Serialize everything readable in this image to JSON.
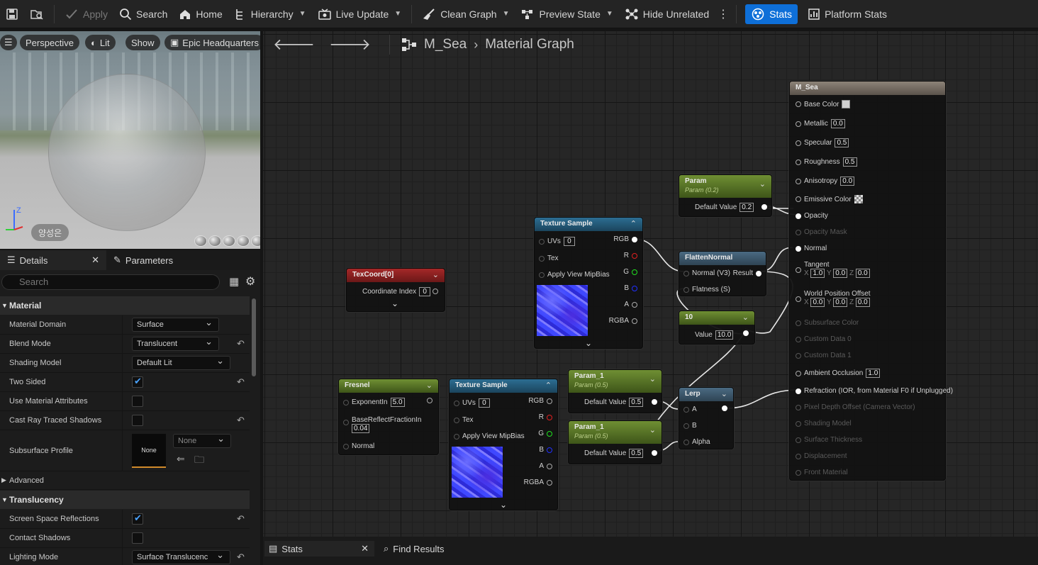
{
  "toolbar": {
    "apply": "Apply",
    "search": "Search",
    "home": "Home",
    "hierarchy": "Hierarchy",
    "live_update": "Live Update",
    "clean_graph": "Clean Graph",
    "preview_state": "Preview State",
    "hide_unrelated": "Hide Unrelated",
    "stats": "Stats",
    "platform_stats": "Platform Stats"
  },
  "viewport": {
    "perspective": "Perspective",
    "lit": "Lit",
    "show": "Show",
    "environment": "Epic Headquarters",
    "user_label": "양성은",
    "axis_z": "Z"
  },
  "details": {
    "tabs": [
      "Details",
      "Parameters"
    ],
    "search_placeholder": "Search",
    "categories": {
      "material": "Material",
      "advanced": "Advanced",
      "translucency": "Translucency"
    },
    "rows": {
      "material_domain": {
        "label": "Material Domain",
        "value": "Surface"
      },
      "blend_mode": {
        "label": "Blend Mode",
        "value": "Translucent"
      },
      "shading_model": {
        "label": "Shading Model",
        "value": "Default Lit"
      },
      "two_sided": {
        "label": "Two Sided",
        "checked": true
      },
      "use_material_attributes": {
        "label": "Use Material Attributes",
        "checked": false
      },
      "cast_ray_traced_shadows": {
        "label": "Cast Ray Traced Shadows",
        "checked": false
      },
      "subsurface_profile": {
        "label": "Subsurface Profile",
        "thumb": "None",
        "value": "None"
      },
      "screen_space_reflections": {
        "label": "Screen Space Reflections",
        "checked": true
      },
      "contact_shadows": {
        "label": "Contact Shadows",
        "checked": false
      },
      "lighting_mode": {
        "label": "Lighting Mode",
        "value": "Surface Translucenc"
      }
    }
  },
  "graph": {
    "asset": "M_Sea",
    "view": "Material Graph",
    "nodes": {
      "texcoord": {
        "title": "TexCoord[0]",
        "pin": "Coordinate Index",
        "value": "0"
      },
      "texsample1": {
        "title": "Texture Sample",
        "inputs": [
          "UVs",
          "Tex",
          "Apply View MipBias"
        ],
        "uvs_value": "0",
        "outputs": [
          "RGB",
          "R",
          "G",
          "B",
          "A",
          "RGBA"
        ]
      },
      "texsample2": {
        "title": "Texture Sample",
        "inputs": [
          "UVs",
          "Tex",
          "Apply View MipBias"
        ],
        "uvs_value": "0",
        "outputs": [
          "RGB",
          "R",
          "G",
          "B",
          "A",
          "RGBA"
        ]
      },
      "fresnel": {
        "title": "Fresnel",
        "exponent_label": "ExponentIn",
        "exponent": "5.0",
        "base_label": "BaseReflectFractionIn",
        "base": "0.04",
        "normal": "Normal"
      },
      "param": {
        "title": "Param",
        "subtitle": "Param (0.2)",
        "pin": "Default Value",
        "value": "0.2"
      },
      "flatten": {
        "title": "FlattenNormal",
        "in1": "Normal (V3)",
        "out": "Result",
        "in2": "Flatness (S)"
      },
      "const10": {
        "title": "10",
        "pin": "Value",
        "value": "10.0"
      },
      "param1a": {
        "title": "Param_1",
        "subtitle": "Param (0.5)",
        "pin": "Default Value",
        "value": "0.5"
      },
      "param1b": {
        "title": "Param_1",
        "subtitle": "Param (0.5)",
        "pin": "Default Value",
        "value": "0.5"
      },
      "lerp": {
        "title": "Lerp",
        "pins": [
          "A",
          "B",
          "Alpha"
        ]
      },
      "result": {
        "title": "M_Sea",
        "base_color": "Base Color",
        "metallic": "Metallic",
        "metallic_v": "0.0",
        "specular": "Specular",
        "specular_v": "0.5",
        "roughness": "Roughness",
        "roughness_v": "0.5",
        "anisotropy": "Anisotropy",
        "anisotropy_v": "0.0",
        "emissive": "Emissive Color",
        "opacity": "Opacity",
        "opacity_mask": "Opacity Mask",
        "normal": "Normal",
        "tangent": "Tangent",
        "tangent_v": [
          "1.0",
          "0.0",
          "0.0"
        ],
        "wpo": "World Position Offset",
        "wpo_v": [
          "0.0",
          "0.0",
          "0.0"
        ],
        "axis_labels": [
          "X",
          "Y",
          "Z"
        ],
        "subsurface": "Subsurface Color",
        "custom0": "Custom Data 0",
        "custom1": "Custom Data 1",
        "ao": "Ambient Occlusion",
        "ao_v": "1.0",
        "refraction": "Refraction (IOR, from Material F0 if Unplugged)",
        "pdo": "Pixel Depth Offset (Camera Vector)",
        "shading_model": "Shading Model",
        "thickness": "Surface Thickness",
        "displacement": "Displacement",
        "front_material": "Front Material"
      }
    }
  },
  "bottom": {
    "stats": "Stats",
    "find_results": "Find Results"
  }
}
